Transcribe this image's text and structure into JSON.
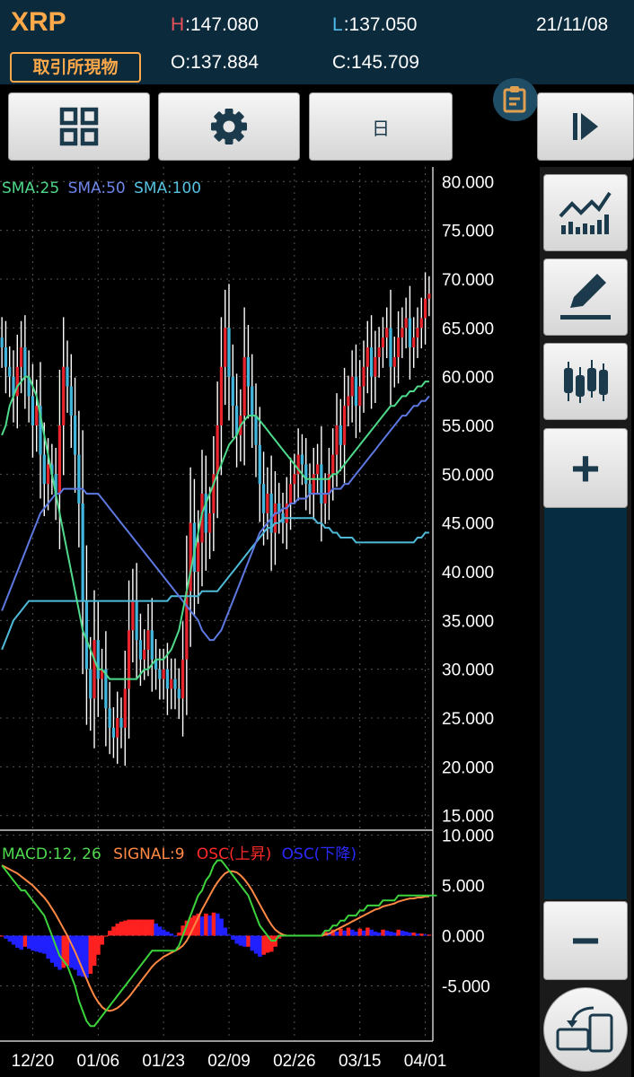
{
  "header": {
    "symbol": "XRP",
    "market": "取引所現物",
    "high_key": "H",
    "high_val": ":147.080",
    "low_key": "L",
    "low_val": ":137.050",
    "open": "O:137.884",
    "close": "C:145.709",
    "date": "21/11/08"
  },
  "toolbar": {
    "layout_icon": "grid-icon",
    "settings_icon": "gear-icon",
    "period_label": "日",
    "play_icon": "play-step-icon",
    "note_icon": "memo-icon"
  },
  "side": {
    "indicator_icon": "line-chart-icon",
    "draw_icon": "pencil-icon",
    "candle_icon": "candlestick-icon",
    "zoom_in": "+",
    "zoom_out": "−",
    "rotate_icon": "rotate-device-icon"
  },
  "colors": {
    "up": "#e8242d",
    "down": "#42b6dc",
    "sma25": "#4fd98a",
    "sma50": "#5d78e0",
    "sma100": "#4fb9d8",
    "macd": "#3cd33c",
    "signal": "#ff8844",
    "osc_up": "#ff2020",
    "osc_down": "#2020ff"
  },
  "chart_data": [
    {
      "type": "candlestick",
      "title": "",
      "legend": [
        {
          "label": "SMA:25",
          "color": "#4fd98a"
        },
        {
          "label": "SMA:50",
          "color": "#6f86e8"
        },
        {
          "label": "SMA:100",
          "color": "#56c2e0"
        }
      ],
      "y_ticks": [
        "80.000",
        "75.000",
        "70.000",
        "65.000",
        "60.000",
        "55.000",
        "50.000",
        "45.000",
        "40.000",
        "35.000",
        "30.000",
        "25.000",
        "20.000",
        "15.000"
      ],
      "ylim": [
        13.5,
        81.5
      ],
      "x_ticks": [
        "12/20",
        "01/06",
        "01/23",
        "02/09",
        "02/26",
        "03/15",
        "04/01"
      ],
      "x_tick_index": [
        8,
        25,
        42,
        59,
        76,
        93,
        110
      ],
      "n_days": 112,
      "close": [
        63,
        61,
        60,
        58,
        61,
        63,
        60,
        58,
        55,
        57,
        52,
        49,
        51,
        50,
        48,
        55,
        61,
        59,
        56,
        52,
        47,
        37,
        30,
        27,
        33,
        29,
        30,
        26,
        24,
        23,
        25,
        24,
        28,
        34,
        37,
        33,
        31,
        32,
        34,
        31,
        30,
        29,
        30,
        28,
        29,
        28,
        27,
        31,
        38,
        45,
        40,
        43,
        48,
        44,
        46,
        50,
        55,
        61,
        65,
        60,
        57,
        54,
        56,
        62,
        59,
        56,
        53,
        49,
        46,
        48,
        44,
        47,
        46,
        45,
        47,
        49,
        50,
        52,
        51,
        49,
        48,
        50,
        51,
        47,
        48,
        50,
        52,
        55,
        53,
        57,
        58,
        60,
        57,
        59,
        61,
        63,
        60,
        62,
        63,
        64,
        65,
        61,
        62,
        64,
        65,
        66,
        63,
        64,
        65,
        66,
        68,
        68.5
      ],
      "sma25": [
        54,
        55,
        57,
        58,
        59,
        59.5,
        60,
        60,
        59,
        58,
        56,
        54,
        52,
        50,
        48,
        46,
        44,
        42,
        40,
        38,
        36,
        34,
        33,
        32,
        31,
        30,
        30,
        29.5,
        29,
        29,
        29,
        29,
        29,
        29,
        29,
        29,
        29.5,
        30,
        30,
        30.5,
        31,
        31,
        31,
        31.5,
        32,
        33,
        34,
        36,
        38,
        40,
        42,
        44,
        46,
        47,
        48,
        49,
        50,
        51,
        52,
        53,
        53.5,
        54,
        55,
        55.5,
        56,
        56,
        56,
        55.5,
        55,
        54.5,
        54,
        53.5,
        53,
        52.5,
        52,
        51.5,
        51,
        50.5,
        50,
        49.5,
        49.5,
        49.5,
        49.5,
        49.5,
        49.5,
        49.5,
        50,
        50,
        50.5,
        51,
        51.5,
        52,
        52.5,
        53,
        53.5,
        54,
        54.5,
        55,
        55.5,
        56,
        56.5,
        57,
        57,
        57.5,
        58,
        58,
        58.5,
        58.5,
        59,
        59,
        59.5,
        59.5
      ],
      "sma50": [
        36,
        37,
        38,
        39,
        40,
        41,
        42,
        43,
        44,
        45,
        46,
        46.5,
        47,
        47.5,
        48,
        48,
        48.5,
        48.5,
        48.5,
        48.5,
        48.5,
        48.5,
        48,
        48,
        48,
        48,
        47.5,
        47,
        46.5,
        46,
        45.5,
        45,
        44.5,
        44,
        43.5,
        43,
        42.5,
        42,
        41.5,
        41,
        40.5,
        40,
        39.5,
        39,
        38.5,
        38,
        37.5,
        37,
        36.5,
        36,
        35.5,
        35,
        34,
        33.5,
        33,
        33,
        33.5,
        34,
        35,
        36,
        37,
        38,
        39,
        40,
        41,
        42,
        43,
        44,
        44.5,
        45,
        45.5,
        46,
        46,
        46.5,
        46.5,
        47,
        47,
        47.5,
        47.5,
        47.5,
        48,
        48,
        48,
        48,
        48,
        48,
        48.5,
        48.5,
        48.5,
        49,
        49,
        49.5,
        50,
        50.5,
        51,
        51.5,
        52,
        52.5,
        53,
        53.5,
        54,
        54.5,
        55,
        55.5,
        56,
        56,
        56.5,
        57,
        57,
        57.5,
        57.5,
        58
      ],
      "sma100": [
        32,
        33,
        34,
        35,
        35.5,
        36,
        36.5,
        37,
        37,
        37,
        37,
        37,
        37,
        37,
        37,
        37,
        37,
        37,
        37,
        37,
        37,
        37,
        37,
        37,
        37,
        37,
        37,
        37,
        37,
        37,
        37,
        37,
        37,
        37,
        37,
        37,
        37,
        37,
        37,
        37,
        37,
        37,
        37,
        37,
        37.5,
        37.5,
        37.5,
        37.5,
        37.5,
        37.5,
        37.5,
        37.5,
        38,
        38,
        38,
        38,
        38,
        38.5,
        39,
        39.5,
        40,
        40.5,
        41,
        41.5,
        42,
        42.5,
        43,
        43.5,
        44,
        44.5,
        44.5,
        45,
        45,
        45.5,
        45.5,
        45.5,
        45.5,
        45.5,
        45.5,
        45.5,
        45.5,
        45.5,
        45,
        45,
        44.5,
        44.5,
        44,
        44,
        43.5,
        43.5,
        43.5,
        43.5,
        43,
        43,
        43,
        43,
        43,
        43,
        43,
        43,
        43,
        43,
        43,
        43,
        43,
        43,
        43,
        43,
        43.5,
        43.5,
        44,
        44
      ]
    },
    {
      "type": "line",
      "title": "",
      "legend": [
        {
          "label": "MACD:12, 26",
          "color": "#4fd94f"
        },
        {
          "label": "SIGNAL:9",
          "color": "#ff8844"
        },
        {
          "label": "OSC(上昇)",
          "color": "#ff2a2a"
        },
        {
          "label": "OSC(下降)",
          "color": "#2a2aff"
        }
      ],
      "y_ticks": [
        "10.000",
        "5.000",
        "0.000",
        "-5.000"
      ],
      "ylim": [
        -10.5,
        10.5
      ],
      "macd": [
        7,
        6.5,
        6,
        5.5,
        5,
        4.5,
        4.5,
        4,
        3.5,
        3,
        2.5,
        2,
        1,
        0,
        -1,
        -2,
        -2.5,
        -3,
        -4,
        -5,
        -6.5,
        -7.5,
        -8.5,
        -9,
        -9,
        -8.5,
        -8,
        -7.5,
        -7,
        -6.5,
        -6,
        -5.5,
        -5,
        -4.5,
        -4,
        -3.5,
        -3,
        -2.5,
        -2,
        -1.5,
        -1.5,
        -1.5,
        -1.5,
        -1.5,
        -1.5,
        -1.5,
        -1,
        0,
        1,
        2,
        3,
        4,
        4.5,
        5.5,
        6,
        7,
        7.5,
        7.5,
        7,
        6.5,
        6,
        5.5,
        5,
        4.5,
        4,
        3,
        2,
        1,
        0.5,
        0,
        -0.5,
        -0.5,
        0,
        0,
        0,
        0,
        0,
        0,
        0,
        0,
        0,
        0,
        0,
        0,
        0.5,
        0.5,
        1,
        1,
        1.5,
        1.5,
        2,
        2,
        2,
        2.5,
        2.5,
        3,
        3,
        3,
        3,
        3.5,
        3.5,
        3.5,
        3.5,
        4,
        4,
        4,
        4,
        4,
        4,
        4,
        4,
        4,
        4,
        4
      ],
      "signal": [
        7,
        6.8,
        6.6,
        6.4,
        6.2,
        5.9,
        5.6,
        5.3,
        5,
        4.6,
        4.2,
        3.8,
        3.3,
        2.7,
        2.1,
        1.4,
        0.7,
        0,
        -0.8,
        -1.6,
        -2.5,
        -3.4,
        -4.3,
        -5.2,
        -6,
        -6.6,
        -7.1,
        -7.4,
        -7.5,
        -7.4,
        -7.2,
        -6.9,
        -6.5,
        -6.1,
        -5.6,
        -5.1,
        -4.6,
        -4.1,
        -3.6,
        -3.1,
        -2.7,
        -2.4,
        -2.1,
        -1.9,
        -1.7,
        -1.5,
        -1.3,
        -1,
        -0.5,
        0.2,
        1,
        1.8,
        2.6,
        3.3,
        4,
        4.7,
        5.3,
        5.8,
        6.2,
        6.4,
        6.4,
        6.3,
        6,
        5.6,
        5.1,
        4.5,
        3.8,
        3.1,
        2.4,
        1.7,
        1.1,
        0.6,
        0.3,
        0.1,
        0,
        0,
        0,
        0,
        0,
        0,
        0,
        0,
        0,
        0,
        0.1,
        0.2,
        0.4,
        0.6,
        0.8,
        1,
        1.2,
        1.4,
        1.6,
        1.8,
        2,
        2.2,
        2.4,
        2.6,
        2.7,
        2.9,
        3,
        3.1,
        3.2,
        3.4,
        3.5,
        3.6,
        3.7,
        3.7,
        3.8,
        3.8,
        3.9,
        3.9
      ]
    }
  ]
}
